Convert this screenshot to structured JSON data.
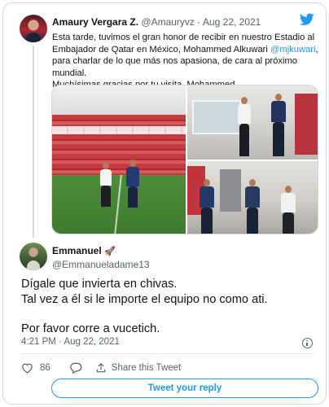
{
  "tweet": {
    "author_name": "Amaury Vergara Z.",
    "handle": "@Amauryvz",
    "separator": "·",
    "date": "Aug 22, 2021",
    "text_line1": "Esta tarde, tuvimos el gran honor de recibir en nuestro Estadio al",
    "text_line2": "Embajador de Qatar en México, Mohammed Alkuwari ",
    "mention": "@mjkuwari",
    "text_line2_end": ",",
    "text_line3": "para charlar de lo que más nos apasiona, de cara al próximo mundial.",
    "text_line4": "Muchísimas gracias por tu visita, Mohammed.",
    "icons": {
      "platform": "twitter-bird-icon",
      "verified": "none"
    },
    "colors": {
      "brand": "#1d9bf0",
      "text": "#0f1419",
      "muted": "#536471"
    }
  },
  "reply": {
    "author_name": "Emmanuel",
    "author_emoji": "🚀",
    "handle": "@Emmanueladame13",
    "line1": "Dígale que invierta en chivas.",
    "line2": "Tal vez a él si le importe el equipo no como ati.",
    "line3": "Por favor corre a vucetich.",
    "timestamp": "4:21 PM · Aug 22, 2021",
    "like_count": "86",
    "share_label": "Share this Tweet",
    "reply_button": "Tweet your reply"
  }
}
